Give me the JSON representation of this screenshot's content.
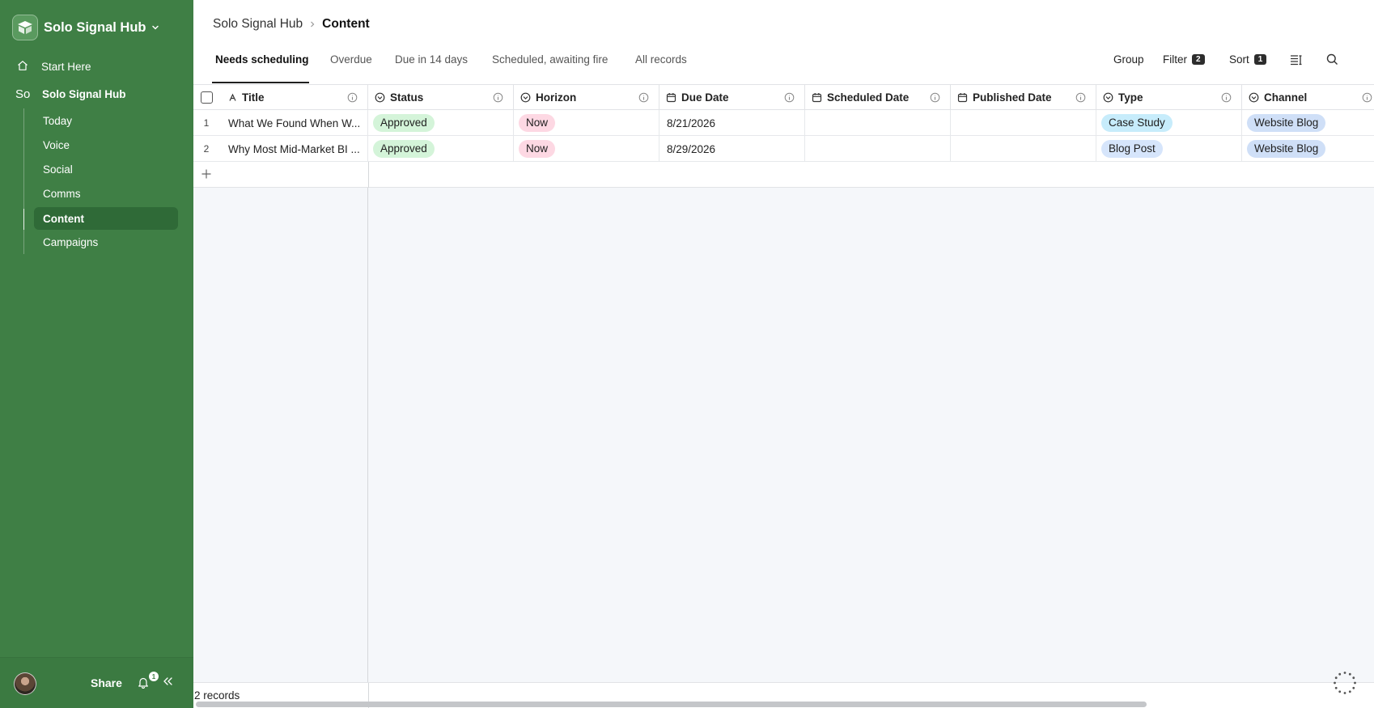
{
  "sidebar": {
    "brand": "Solo Signal Hub",
    "start_here": "Start Here",
    "hub_abbr": "So",
    "hub_name": "Solo Signal Hub",
    "items": [
      {
        "label": "Today"
      },
      {
        "label": "Voice"
      },
      {
        "label": "Social"
      },
      {
        "label": "Comms"
      },
      {
        "label": "Content"
      },
      {
        "label": "Campaigns"
      }
    ],
    "active_item": "Content",
    "footer": {
      "share": "Share",
      "notification_count": "1"
    }
  },
  "breadcrumb": {
    "parent": "Solo Signal Hub",
    "current": "Content"
  },
  "tabs": [
    {
      "label": "Needs scheduling"
    },
    {
      "label": "Overdue"
    },
    {
      "label": "Due in 14 days"
    },
    {
      "label": "Scheduled, awaiting fire"
    },
    {
      "label": "All records"
    }
  ],
  "active_tab": "Needs scheduling",
  "toolbar": {
    "group": "Group",
    "filter": "Filter",
    "filter_count": "2",
    "sort": "Sort",
    "sort_count": "1"
  },
  "columns": [
    {
      "label": "Title",
      "icon": "text-sort-icon"
    },
    {
      "label": "Status",
      "icon": "chevron-circle-icon"
    },
    {
      "label": "Horizon",
      "icon": "chevron-circle-icon"
    },
    {
      "label": "Due Date",
      "icon": "calendar-icon"
    },
    {
      "label": "Scheduled Date",
      "icon": "calendar-icon"
    },
    {
      "label": "Published Date",
      "icon": "calendar-icon"
    },
    {
      "label": "Type",
      "icon": "chevron-circle-icon"
    },
    {
      "label": "Channel",
      "icon": "chevron-circle-icon"
    }
  ],
  "rows": [
    {
      "num": "1",
      "title": "What We Found When W...",
      "status": "Approved",
      "horizon": "Now",
      "due_date": "8/21/2026",
      "scheduled_date": "",
      "published_date": "",
      "type": "Case Study",
      "channel": "Website Blog"
    },
    {
      "num": "2",
      "title": "Why Most Mid-Market BI ...",
      "status": "Approved",
      "horizon": "Now",
      "due_date": "8/29/2026",
      "scheduled_date": "",
      "published_date": "",
      "type": "Blog Post",
      "channel": "Website Blog"
    }
  ],
  "footer": {
    "record_count": "2 records"
  },
  "colors": {
    "sidebar_bg": "#3f7f45",
    "approved_pill": "#d4f4d9",
    "now_pill": "#fdd8e3",
    "case_study_pill": "#c7ecfb",
    "blog_post_pill": "#d6e5fb",
    "website_blog_pill": "#cfdff7"
  }
}
